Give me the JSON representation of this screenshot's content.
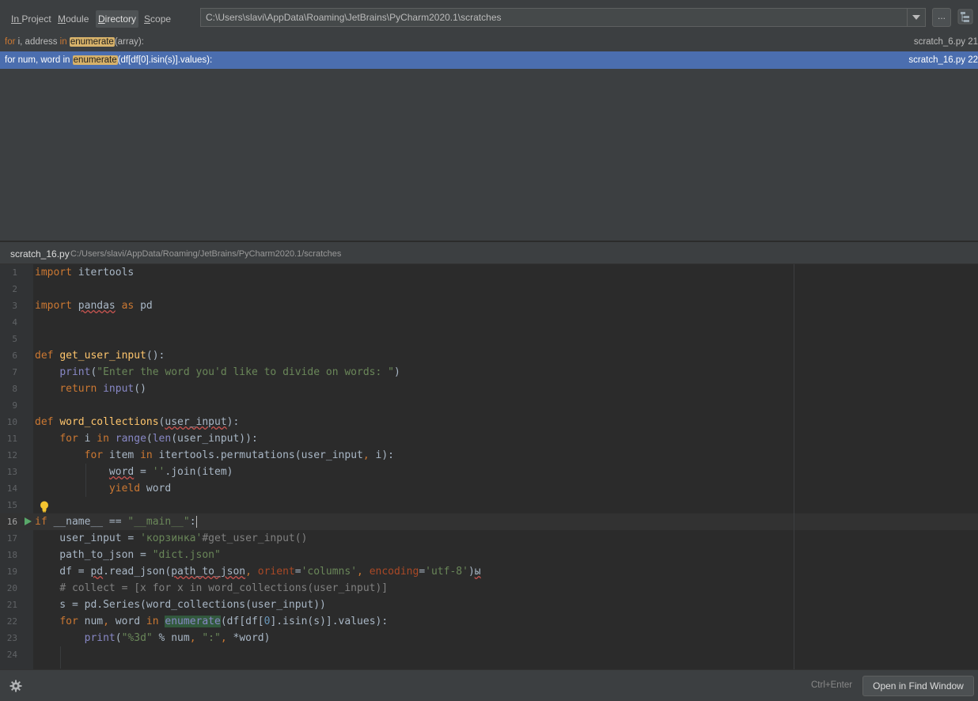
{
  "scope_bar": {
    "tabs": [
      {
        "mnemonic": "In ",
        "rest": "Project"
      },
      {
        "mnemonic": "M",
        "rest": "odule"
      },
      {
        "mnemonic": "D",
        "rest": "irectory"
      },
      {
        "mnemonic": "S",
        "rest": "cope"
      }
    ],
    "selected_tab": "Directory",
    "directory_path": "C:\\Users\\slavi\\AppData\\Roaming\\JetBrains\\PyCharm2020.1\\scratches",
    "browse_label": "..."
  },
  "results": [
    {
      "kw1": "for",
      "pre": " i, address ",
      "kw2": "in",
      "match": "enumerate",
      "post": "(array):",
      "file": "scratch_6.py 21",
      "selected": false
    },
    {
      "kw1": "for",
      "pre": " num, word ",
      "kw2": "in",
      "match": "enumerate",
      "post": "(df[df[0].isin(s)].values):",
      "file": "scratch_16.py 22",
      "selected": true
    }
  ],
  "preview": {
    "file_name": "scratch_16.py",
    "file_path": "C:/Users/slavi/AppData/Roaming/JetBrains/PyCharm2020.1/scratches"
  },
  "editor": {
    "current_line": 16,
    "line_numbers": [
      "1",
      "2",
      "3",
      "4",
      "5",
      "6",
      "7",
      "8",
      "9",
      "10",
      "11",
      "12",
      "13",
      "14",
      "15",
      "16",
      "17",
      "18",
      "19",
      "20",
      "21",
      "22",
      "23",
      "24"
    ]
  },
  "footer": {
    "shortcut": "Ctrl+Enter",
    "open_button": "Open in Find Window"
  },
  "colors": {
    "selection": "#4b6eaf",
    "editor_bg": "#2b2b2b",
    "keyword": "#cc7832",
    "string": "#6a8759",
    "function": "#ffc66d"
  }
}
